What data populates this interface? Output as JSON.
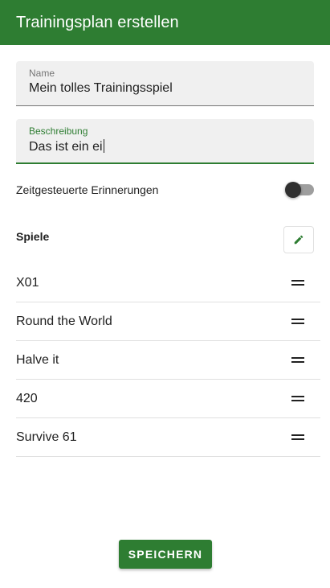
{
  "appbar": {
    "title": "Trainingsplan erstellen"
  },
  "name_field": {
    "label": "Name",
    "value": "Mein tolles Trainingsspiel"
  },
  "description_field": {
    "label": "Beschreibung",
    "value": "Das ist ein ei"
  },
  "reminders": {
    "label": "Zeitgesteuerte Erinnerungen",
    "enabled": false
  },
  "games": {
    "title": "Spiele",
    "edit_icon": "pencil-icon",
    "drag_icon": "drag-handle-icon",
    "items": [
      "X01",
      "Round the World",
      "Halve it",
      "420",
      "Survive 61"
    ]
  },
  "save_button": {
    "label": "SPEICHERN"
  },
  "colors": {
    "primary": "#2e7d32",
    "field_bg": "#f0f0f0"
  }
}
